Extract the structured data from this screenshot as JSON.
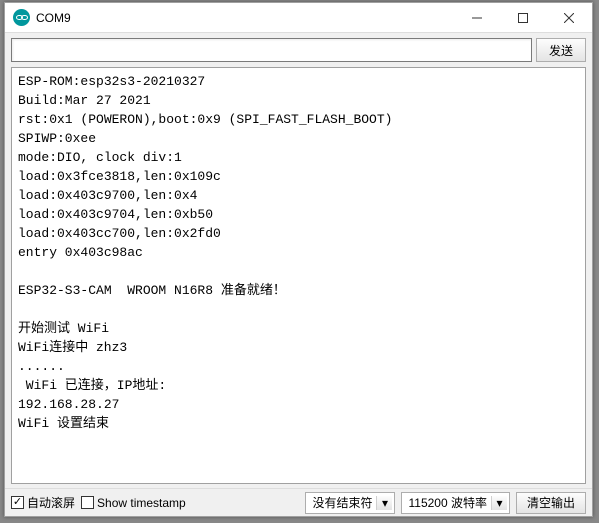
{
  "window": {
    "title": "COM9"
  },
  "toolbar": {
    "input_value": "",
    "send_label": "发送"
  },
  "console": {
    "lines": [
      "ESP-ROM:esp32s3-20210327",
      "Build:Mar 27 2021",
      "rst:0x1 (POWERON),boot:0x9 (SPI_FAST_FLASH_BOOT)",
      "SPIWP:0xee",
      "mode:DIO, clock div:1",
      "load:0x3fce3818,len:0x109c",
      "load:0x403c9700,len:0x4",
      "load:0x403c9704,len:0xb50",
      "load:0x403cc700,len:0x2fd0",
      "entry 0x403c98ac",
      "",
      "ESP32-S3-CAM  WROOM N16R8 准备就绪！",
      "",
      "开始测试 WiFi",
      "WiFi连接中 zhz3",
      "......",
      " WiFi 已连接，IP地址:",
      "192.168.28.27",
      "WiFi 设置结束"
    ]
  },
  "statusbar": {
    "autoscroll_label": "自动滚屏",
    "autoscroll_checked": true,
    "timestamp_label": "Show timestamp",
    "timestamp_checked": false,
    "line_ending_selected": "没有结束符",
    "baud_selected": "115200 波特率",
    "clear_label": "清空输出"
  }
}
